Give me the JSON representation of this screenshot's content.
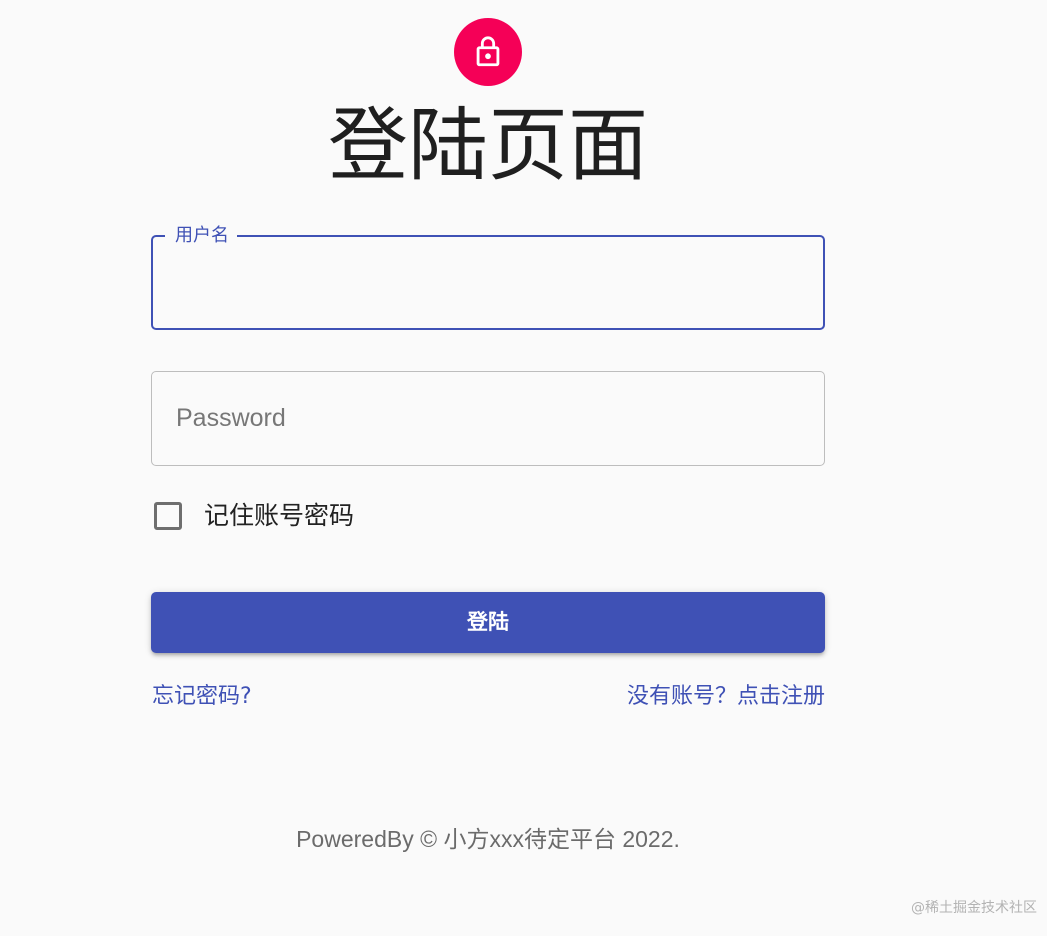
{
  "header": {
    "icon": "lock-icon",
    "title": "登陆页面"
  },
  "form": {
    "username_label": "用户名",
    "username_value": "",
    "password_placeholder": "Password",
    "remember_label": "记住账号密码",
    "remember_checked": false,
    "submit_label": "登陆",
    "forgot_link": "忘记密码?",
    "register_link": "没有账号？点击注册"
  },
  "footer": {
    "copyright": "PoweredBy © 小方xxx待定平台 2022."
  },
  "watermark": "@稀土掘金技术社区",
  "colors": {
    "primary": "#3f51b5",
    "avatar": "#f50057",
    "background": "#fafafa"
  }
}
